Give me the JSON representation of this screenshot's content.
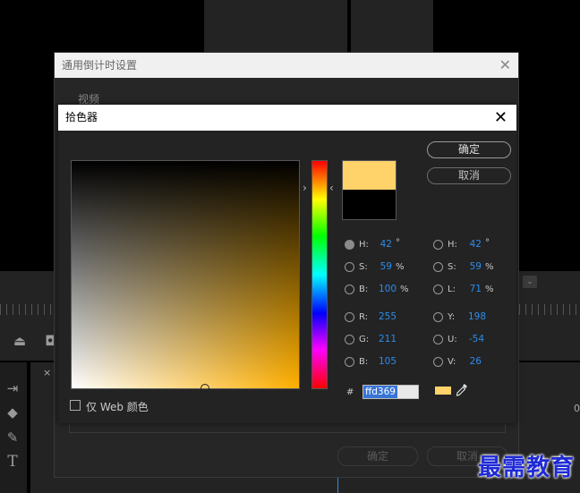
{
  "outer_dialog": {
    "title": "通用倒计时设置",
    "section_label": "视频",
    "ok_label": "确定",
    "cancel_label": "取消"
  },
  "color_picker": {
    "title": "拾色器",
    "ok_label": "确定",
    "cancel_label": "取消",
    "new_color": "#ffd369",
    "old_color": "#000000",
    "hue_degrees": 42,
    "hsb": [
      {
        "label": "H:",
        "value": "42",
        "unit": "°",
        "selected": true
      },
      {
        "label": "S:",
        "value": "59",
        "unit": "%",
        "selected": false
      },
      {
        "label": "B:",
        "value": "100",
        "unit": "%",
        "selected": false
      }
    ],
    "rgb": [
      {
        "label": "R:",
        "value": "255",
        "selected": false
      },
      {
        "label": "G:",
        "value": "211",
        "selected": false
      },
      {
        "label": "B:",
        "value": "105",
        "selected": false
      }
    ],
    "hsl": [
      {
        "label": "H:",
        "value": "42",
        "unit": "°",
        "selected": false
      },
      {
        "label": "S:",
        "value": "59",
        "unit": "%",
        "selected": false
      },
      {
        "label": "L:",
        "value": "71",
        "unit": "%",
        "selected": false
      }
    ],
    "yuv": [
      {
        "label": "Y:",
        "value": "198",
        "selected": false
      },
      {
        "label": "U:",
        "value": "-54",
        "selected": false
      },
      {
        "label": "V:",
        "value": "26",
        "selected": false
      }
    ],
    "hex_prefix": "#",
    "hex_value": "ffd369",
    "web_only_label": "仅 Web 颜色",
    "web_only_checked": false
  },
  "background_app": {
    "timeline_marker": "0"
  },
  "watermark": "最需教育",
  "icons": [
    "close-icon",
    "eyedropper-icon",
    "hue-slider-arrow-icon"
  ]
}
